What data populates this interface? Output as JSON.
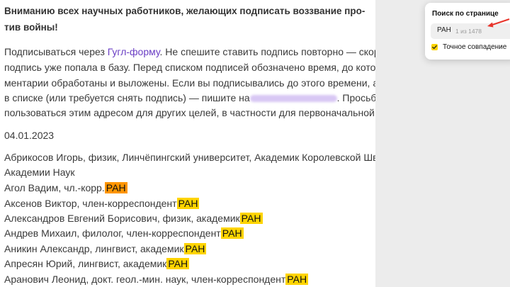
{
  "article": {
    "heading_l1": "Вниманию всех научных работников, желающих подписать воззвание про-",
    "heading_l2": "тив войны!",
    "p_l1_pre": "Подписываться через ",
    "p_l1_link": "Гугл-форму",
    "p_l1_post": ". Не спешите ставить подпись повторно — скорее всего,",
    "p_l2": "подпись уже попала в базу. Перед списком подписей обозначено время, до которого ком-",
    "p_l3": "ментарии обработаны и выложены. Если вы подписывались до этого времени, а вас нет",
    "p_l4_pre": "в списке (или требуется снять подпись) — пишите на",
    "p_l4_post": ". Просьба не",
    "p_l5": "пользоваться этим адресом для других целей, в частности для первоначальной подписи.",
    "date": "04.01.2023",
    "entries": [
      {
        "l1": "Абрикосов Игорь, физик, Линчёпингский университет, Академик Королевской Шведской",
        "l2": "Академии Наук",
        "hl": ""
      },
      {
        "l1": "Агол Вадим, чл.-корр.",
        "hl": "РАН",
        "current": true
      },
      {
        "l1": "Аксенов Виктор, член-корреспондент",
        "hl": "РАН"
      },
      {
        "l1": "Александров Евгений Борисович, физик, академик",
        "hl": "РАН"
      },
      {
        "l1": "Андрев Михаил, филолог, член-корреспондент",
        "hl": "РАН"
      },
      {
        "l1": "Аникин Александр, лингвист, академик",
        "hl": "РАН"
      },
      {
        "l1": "Апресян Юрий, лингвист, академик",
        "hl": "РАН"
      },
      {
        "l1": "Аранович Леонид, докт. геол.-мин. наук, член-корреспондент",
        "hl": "РАН"
      }
    ]
  },
  "find_panel": {
    "title": "Поиск по странице",
    "query": "РАН",
    "count": "1 из 1478",
    "exact_label": "Точное совпадение",
    "exact_checked": true
  },
  "colors": {
    "highlight": "#ffd400",
    "current_highlight": "#ff9500",
    "link": "#6a3ec4",
    "arrow": "#e8332a"
  }
}
